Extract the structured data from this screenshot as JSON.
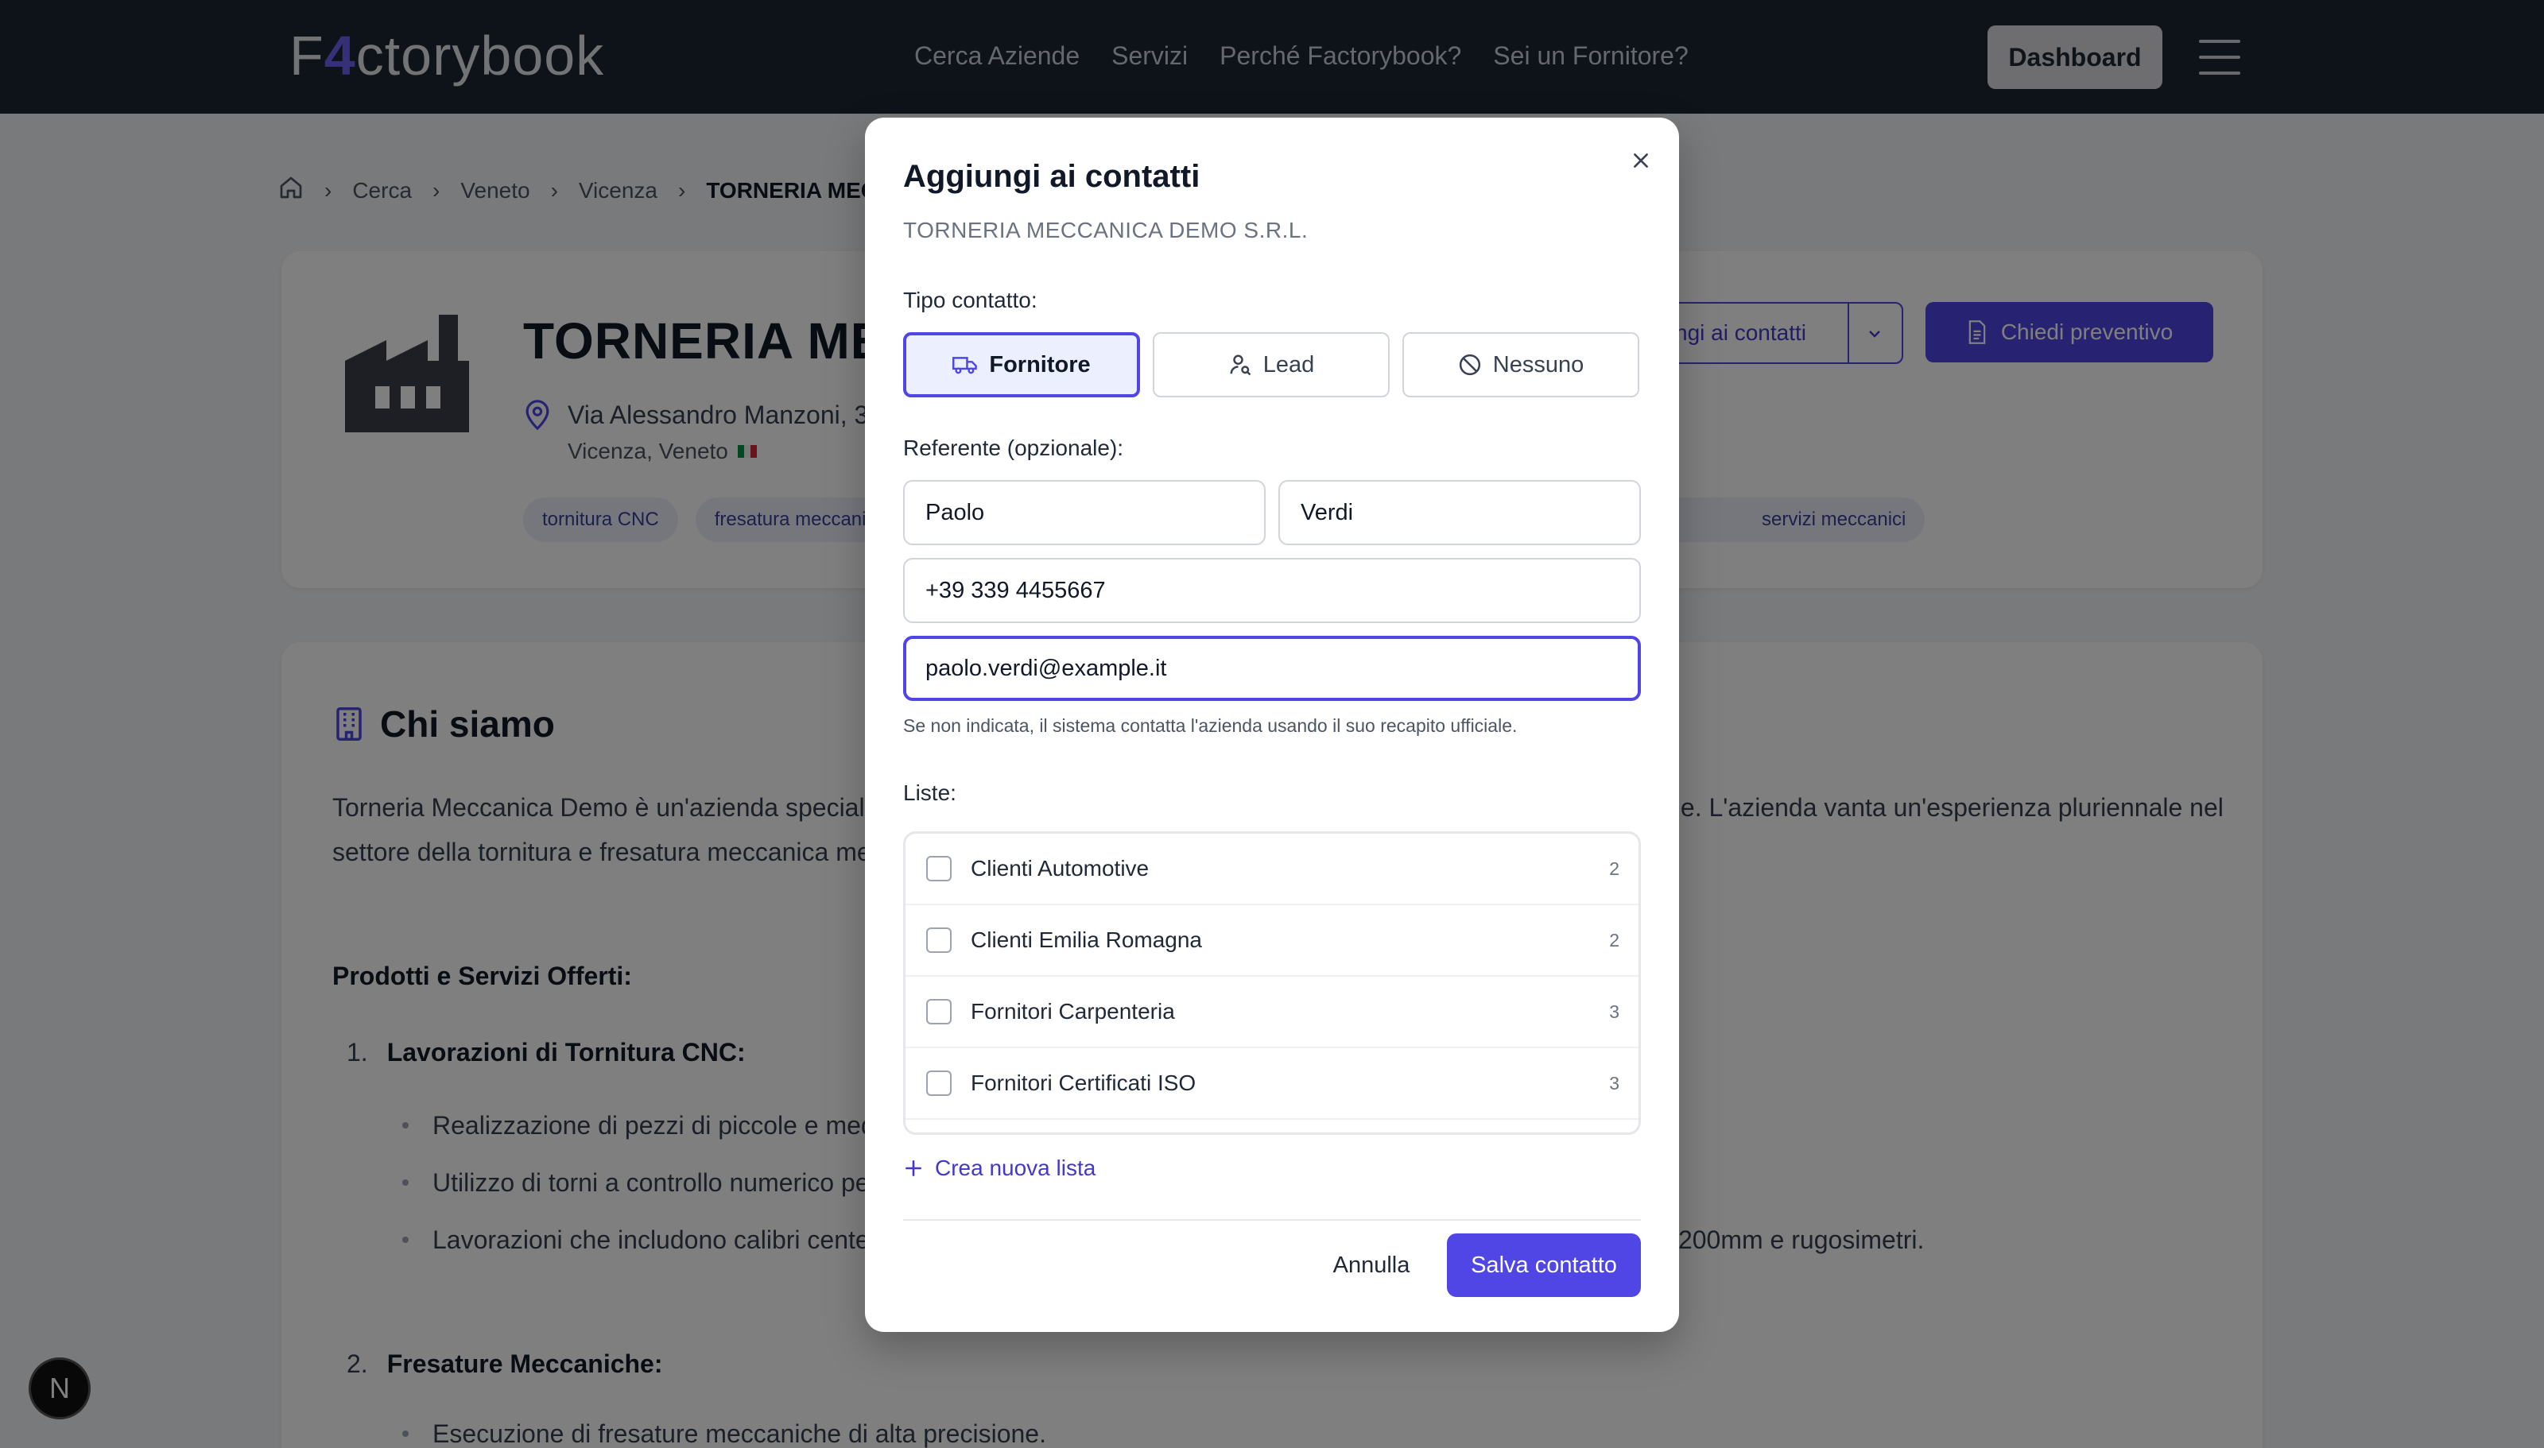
{
  "header": {
    "logo_prefix": "F",
    "logo_mark": "4",
    "logo_suffix": "ctorybook",
    "nav": [
      "Cerca Aziende",
      "Servizi",
      "Perché Factorybook?",
      "Sei un Fornitore?"
    ],
    "dashboard_label": "Dashboard"
  },
  "breadcrumb": {
    "items": [
      "Cerca",
      "Veneto",
      "Vicenza"
    ],
    "current": "TORNERIA MECCANICA DEMO S.R.L."
  },
  "company": {
    "name": "TORNERIA MECCANICA DEMO S.R.L.",
    "address": "Via Alessandro Manzoni, 3",
    "city_region": "Vicenza, Veneto",
    "tags": [
      "tornitura CNC",
      "fresatura meccanica"
    ],
    "tag_right": "servizi meccanici",
    "add_contacts_label": "Aggiungi ai contatti",
    "quote_label": "Chiedi preventivo"
  },
  "about": {
    "title": "Chi siamo",
    "left_text": "Torneria Meccanica Demo è un'azienda specializzata",
    "paragraph_1": "Torneria Meccanica Demo è un'azienda specializzata nella produzione e fornitura di lavorazioni meccaniche di precisione. L'azienda vanta un'esperienza pluriennale nel settore della tornitura e fresatura meccanica medio pesante a controllo numerico (CNC).",
    "products_heading": "Prodotti e Servizi Offerti:",
    "section_1": {
      "number": "1.",
      "title": "Lavorazioni di Tornitura CNC:",
      "bullets": [
        "Realizzazione di pezzi di piccole e medie dimensioni",
        "Utilizzo di torni a controllo numerico per",
        "Lavorazioni che includono calibri centesimali, micrometri per esterni e interni fino a 250mm, alesametri da 50-1200mm e rugosimetri."
      ]
    },
    "section_2": {
      "number": "2.",
      "title": "Fresature Meccaniche:",
      "bullets": [
        "Esecuzione di fresature meccaniche di alta precisione."
      ]
    }
  },
  "next_badge": "N",
  "modal": {
    "title": "Aggiungi ai contatti",
    "subtitle": "TORNERIA MECCANICA DEMO S.R.L.",
    "type_label": "Tipo contatto:",
    "types": [
      {
        "label": "Fornitore",
        "icon": "truck-icon",
        "active": true
      },
      {
        "label": "Lead",
        "icon": "user-search-icon",
        "active": false
      },
      {
        "label": "Nessuno",
        "icon": "ban-icon",
        "active": false
      }
    ],
    "referent_label": "Referente (opzionale):",
    "first_name": "Paolo",
    "last_name": "Verdi",
    "phone": "+39 339 4455667",
    "email": "paolo.verdi@example.it",
    "helper": "Se non indicata, il sistema contatta l'azienda usando il suo recapito ufficiale.",
    "lists_label": "Liste:",
    "lists": [
      {
        "name": "Clienti Automotive",
        "count": "2"
      },
      {
        "name": "Clienti Emilia Romagna",
        "count": "2"
      },
      {
        "name": "Fornitori Carpenteria",
        "count": "3"
      },
      {
        "name": "Fornitori Certificati ISO",
        "count": "3"
      }
    ],
    "create_list_label": "Crea nuova lista",
    "cancel_label": "Annulla",
    "save_label": "Salva contatto"
  },
  "colors": {
    "accent": "#4f46e5",
    "header_bg": "#1d2433",
    "tag_bg": "#eceffa"
  }
}
